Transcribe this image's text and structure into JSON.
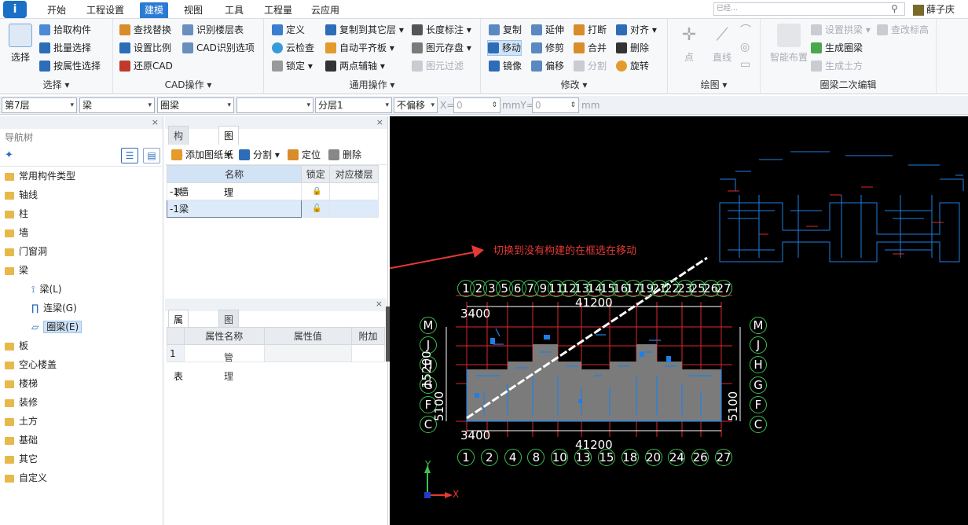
{
  "menu": {
    "logo": "i",
    "tabs": [
      "开始",
      "工程设置",
      "建模",
      "视图",
      "工具",
      "工程量",
      "云应用"
    ],
    "active_tab": "建模",
    "search_placeholder": "已经…",
    "user_name": "薛子庆"
  },
  "ribbon": {
    "select_group": {
      "big_label": "选择",
      "items": [
        "拾取构件",
        "批量选择",
        "按属性选择"
      ],
      "label": "选择"
    },
    "cad_group": {
      "items": [
        "查找替换",
        "识别楼层表",
        "设置比例",
        "CAD识别选项",
        "还原CAD"
      ],
      "label": "CAD操作"
    },
    "common_group": {
      "items": [
        "定义",
        "复制到其它层",
        "长度标注",
        "云检查",
        "自动平齐板",
        "图元存盘",
        "锁定",
        "两点辅轴",
        "图元过滤"
      ],
      "label": "通用操作"
    },
    "modify_group": {
      "items": [
        "复制",
        "延伸",
        "打断",
        "对齐",
        "移动",
        "修剪",
        "合并",
        "删除",
        "镜像",
        "偏移",
        "分割",
        "旋转"
      ],
      "label": "修改"
    },
    "draw_group": {
      "items": [
        "点",
        "直线"
      ],
      "label": "绘图"
    },
    "ring_group": {
      "big_label": "智能布置",
      "items": [
        "设置拱梁",
        "查改标高",
        "生成圈梁",
        "生成土方"
      ],
      "label": "圈梁二次编辑"
    }
  },
  "propbar": {
    "floor": "第7层",
    "type": "梁",
    "subtype": "圈梁",
    "empty": "",
    "layer": "分层1",
    "offset_mode": "不偏移",
    "x_label": "X=",
    "x_value": "0",
    "mm_y_label": "mmY=",
    "y_value": "0",
    "mm_label": "mm"
  },
  "nav": {
    "title": "导航树",
    "items": [
      "常用构件类型",
      "轴线",
      "柱",
      "墙",
      "门窗洞",
      "梁",
      "板",
      "空心楼盖",
      "楼梯",
      "装修",
      "土方",
      "基础",
      "其它",
      "自定义"
    ],
    "beam_children": [
      "梁(L)",
      "连梁(G)",
      "圈梁(E)"
    ]
  },
  "drawing_panel": {
    "tabs": [
      "构件列表",
      "图纸管理"
    ],
    "toolbar": [
      "添加图纸",
      "分割",
      "定位",
      "删除"
    ],
    "columns": [
      "名称",
      "锁定",
      "对应楼层"
    ],
    "rows": [
      {
        "name": "-1墙",
        "lock": "🔒",
        "floor": ""
      },
      {
        "name": "-1梁",
        "lock": "🔓",
        "floor": ""
      }
    ]
  },
  "property_panel": {
    "tabs": [
      "属性列表",
      "图层管理"
    ],
    "columns": [
      "属性名称",
      "属性值",
      "附加"
    ],
    "rows": [
      {
        "index": "1",
        "name": "",
        "value": "",
        "extra": ""
      }
    ]
  },
  "canvas": {
    "annotation": "切换到没有构建的在框选在移动",
    "axis_top": [
      "1",
      "2",
      "3",
      "5",
      "6",
      "7",
      "9",
      "11",
      "12",
      "13",
      "14",
      "15",
      "16",
      "17",
      "19",
      "21",
      "22",
      "23",
      "25",
      "26",
      "27"
    ],
    "axis_bottom": [
      "1",
      "2",
      "4",
      "8",
      "10",
      "13",
      "15",
      "18",
      "20",
      "24",
      "26",
      "27"
    ],
    "axis_left": [
      "M",
      "J",
      "H",
      "G",
      "F",
      "C"
    ],
    "axis_right": [
      "M",
      "J",
      "H",
      "G",
      "F",
      "C"
    ],
    "dim_total": "41200",
    "dim_top_row": "3400",
    "dim_bottom_row": "3400",
    "dim_left": "15200",
    "dim_left_sub": "5100",
    "axis_x_label": "X",
    "axis_y_label": "Y",
    "colors": {
      "background": "#000000",
      "grid": "#e0262a",
      "component": "#1e7fe6",
      "fill": "#7b7b7b",
      "bubble": "#3cc14f",
      "annotation": "#e53935",
      "select_line": "#ffffff"
    }
  }
}
